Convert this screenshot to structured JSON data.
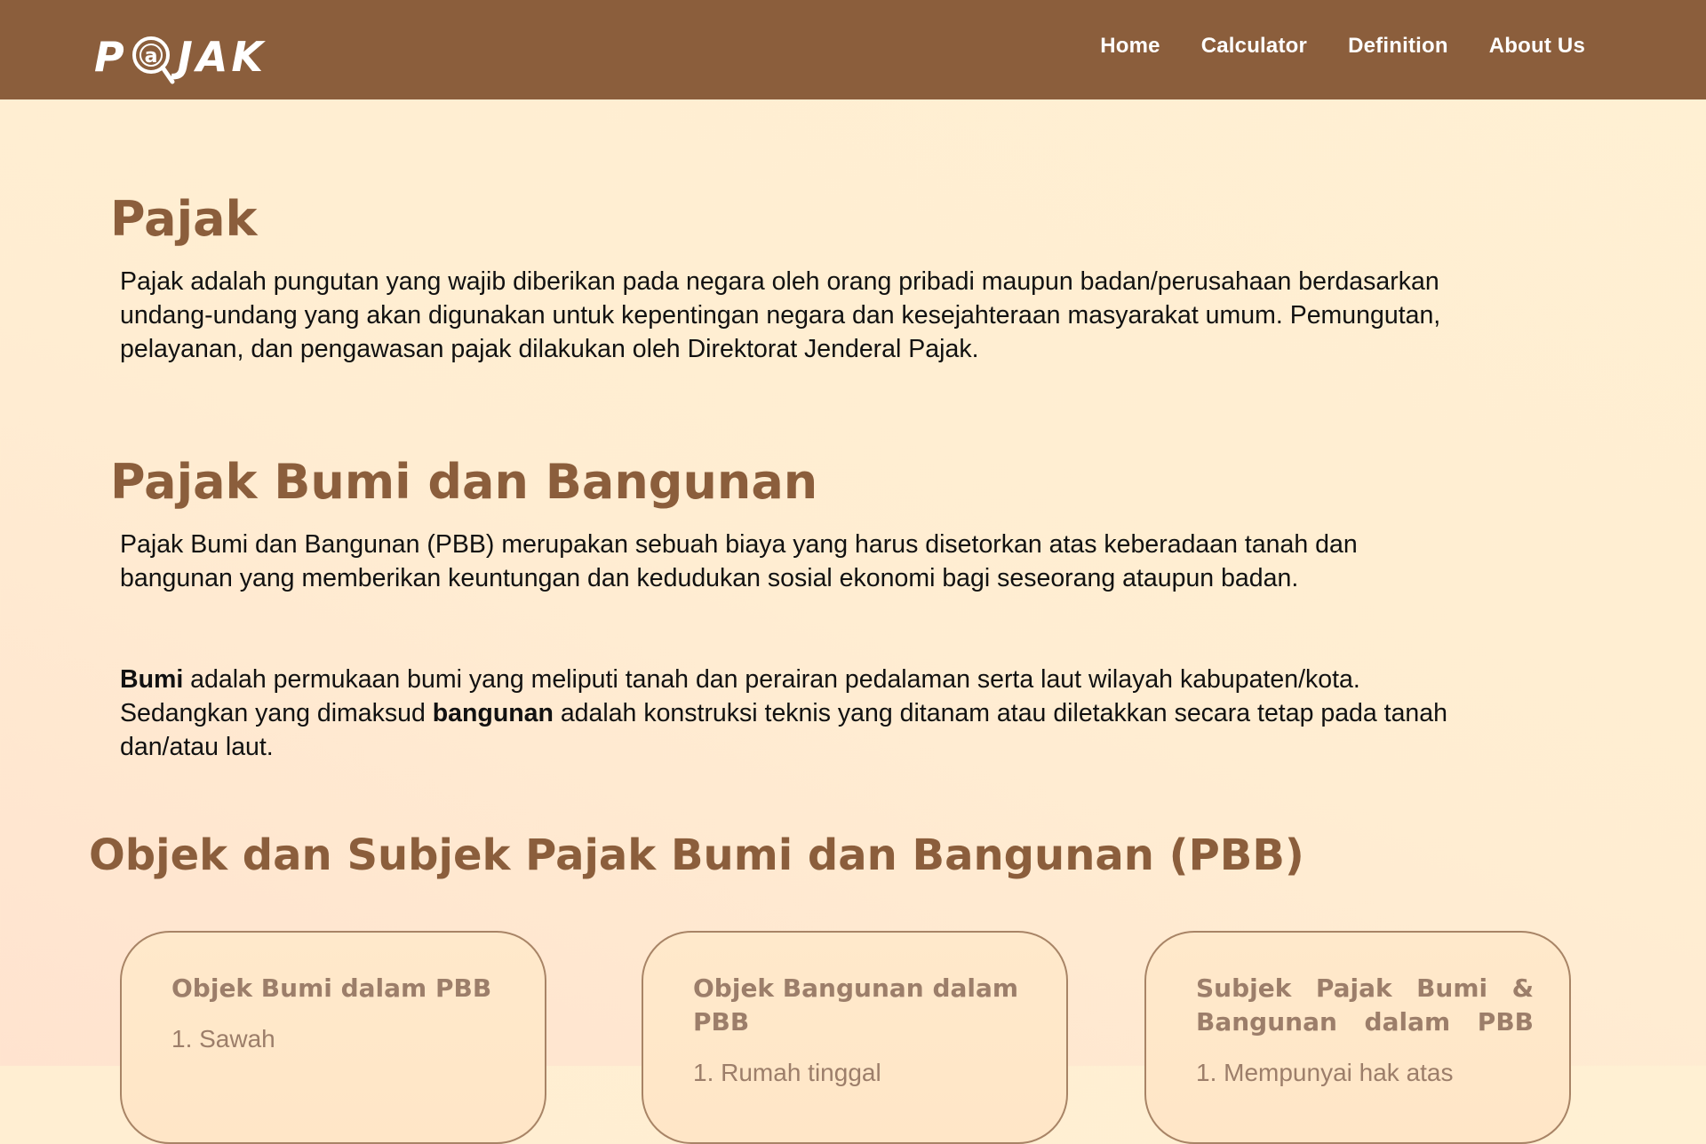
{
  "nav": {
    "logo_text_left": "P",
    "logo_text_ring": "a",
    "logo_text_right": "JAK",
    "links": [
      "Home",
      "Calculator",
      "Definition",
      "About Us"
    ]
  },
  "sections": {
    "pajak": {
      "title": "Pajak",
      "body": "Pajak adalah pungutan yang wajib diberikan pada negara oleh orang pribadi maupun badan/perusahaan berdasarkan undang-undang yang akan digunakan untuk kepentingan negara dan kesejahteraan masyarakat umum. Pemungutan, pelayanan, dan pengawasan pajak dilakukan oleh Direktorat Jenderal Pajak."
    },
    "pbb": {
      "title": "Pajak Bumi dan Bangunan",
      "body1": "Pajak Bumi dan Bangunan (PBB) merupakan sebuah biaya yang harus disetorkan atas keberadaan tanah dan bangunan yang memberikan keuntungan dan kedudukan sosial ekonomi bagi seseorang ataupun badan.",
      "body2_bold1": "Bumi",
      "body2_text1": " adalah permukaan bumi yang meliputi tanah dan perairan pedalaman serta laut wilayah kabupaten/kota. Sedangkan yang dimaksud ",
      "body2_bold2": "bangunan",
      "body2_text2": " adalah konstruksi teknis yang ditanam atau diletakkan secara tetap pada tanah dan/atau laut."
    },
    "objek": {
      "title": "Objek dan Subjek Pajak Bumi dan Bangunan (PBB)"
    }
  },
  "cards": [
    {
      "title": "Objek Bumi dalam PBB",
      "items": [
        "1. Sawah"
      ]
    },
    {
      "title": "Objek Bangunan dalam PBB",
      "items": [
        "1. Rumah tinggal"
      ]
    },
    {
      "title": "Subjek Pajak Bumi & Bangunan dalam PBB",
      "items": [
        "1. Mempunyai hak atas"
      ]
    }
  ],
  "colors": {
    "navbar": "#8b5e3c",
    "heading": "#8b5e3c",
    "card_text": "#9c7e6a",
    "background": "#ffedd2"
  }
}
